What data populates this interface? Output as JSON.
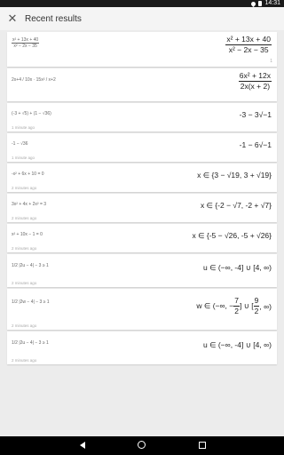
{
  "status": {
    "time": "14:31"
  },
  "header": {
    "title": "Recent results"
  },
  "cards": [
    {
      "problem_num": "x² + 13x + 40",
      "problem_den": "x² − 2x − 35",
      "time": "",
      "result_num": "x² + 13x + 40",
      "result_den": "x² − 2x − 35",
      "result_extra": "1"
    },
    {
      "problem": "2x+4 / 10x · 15x² / x+2",
      "time": "",
      "result_num": "6x² + 12x",
      "result_den": "2x(x + 2)"
    },
    {
      "problem": "(-3 + √5) + (1 − √36)",
      "time": "1 minute ago",
      "result": "-3 − 3√−1"
    },
    {
      "problem": "-1 − √36",
      "time": "1 minute ago",
      "result": "-1 − 6√−1"
    },
    {
      "problem": "-x² + 6x + 10 = 0",
      "time": "2 minutes ago",
      "result": "x ∈ {3 − √19, 3 + √19}"
    },
    {
      "problem": "3x² + 4x + 2x² = 3",
      "time": "2 minutes ago",
      "result": "x ∈ {-2 − √7, -2 + √7}"
    },
    {
      "problem": "x² + 10x − 1 = 0",
      "time": "2 minutes ago",
      "result": "x ∈ {-5 − √26, -5 + √26}"
    },
    {
      "problem": "1/2 |2u − 4| − 3 ≥ 1",
      "time": "2 minutes ago",
      "result": "u ∈ (−∞, -4] ∪ [4, ∞)"
    },
    {
      "problem": "1/2 |2w − 4| − 3 ≥ 1",
      "time": "2 minutes ago",
      "result_pre": "w ∈ (−∞, −",
      "result_f1_num": "7",
      "result_f1_den": "2",
      "result_mid": "] ∪ [",
      "result_f2_num": "9",
      "result_f2_den": "2",
      "result_post": ", ∞)"
    },
    {
      "problem": "1/2 |2u − 4| − 3 ≥ 1",
      "time": "2 minutes ago",
      "result": "u ∈ (−∞, -4] ∪ [4, ∞)"
    }
  ]
}
